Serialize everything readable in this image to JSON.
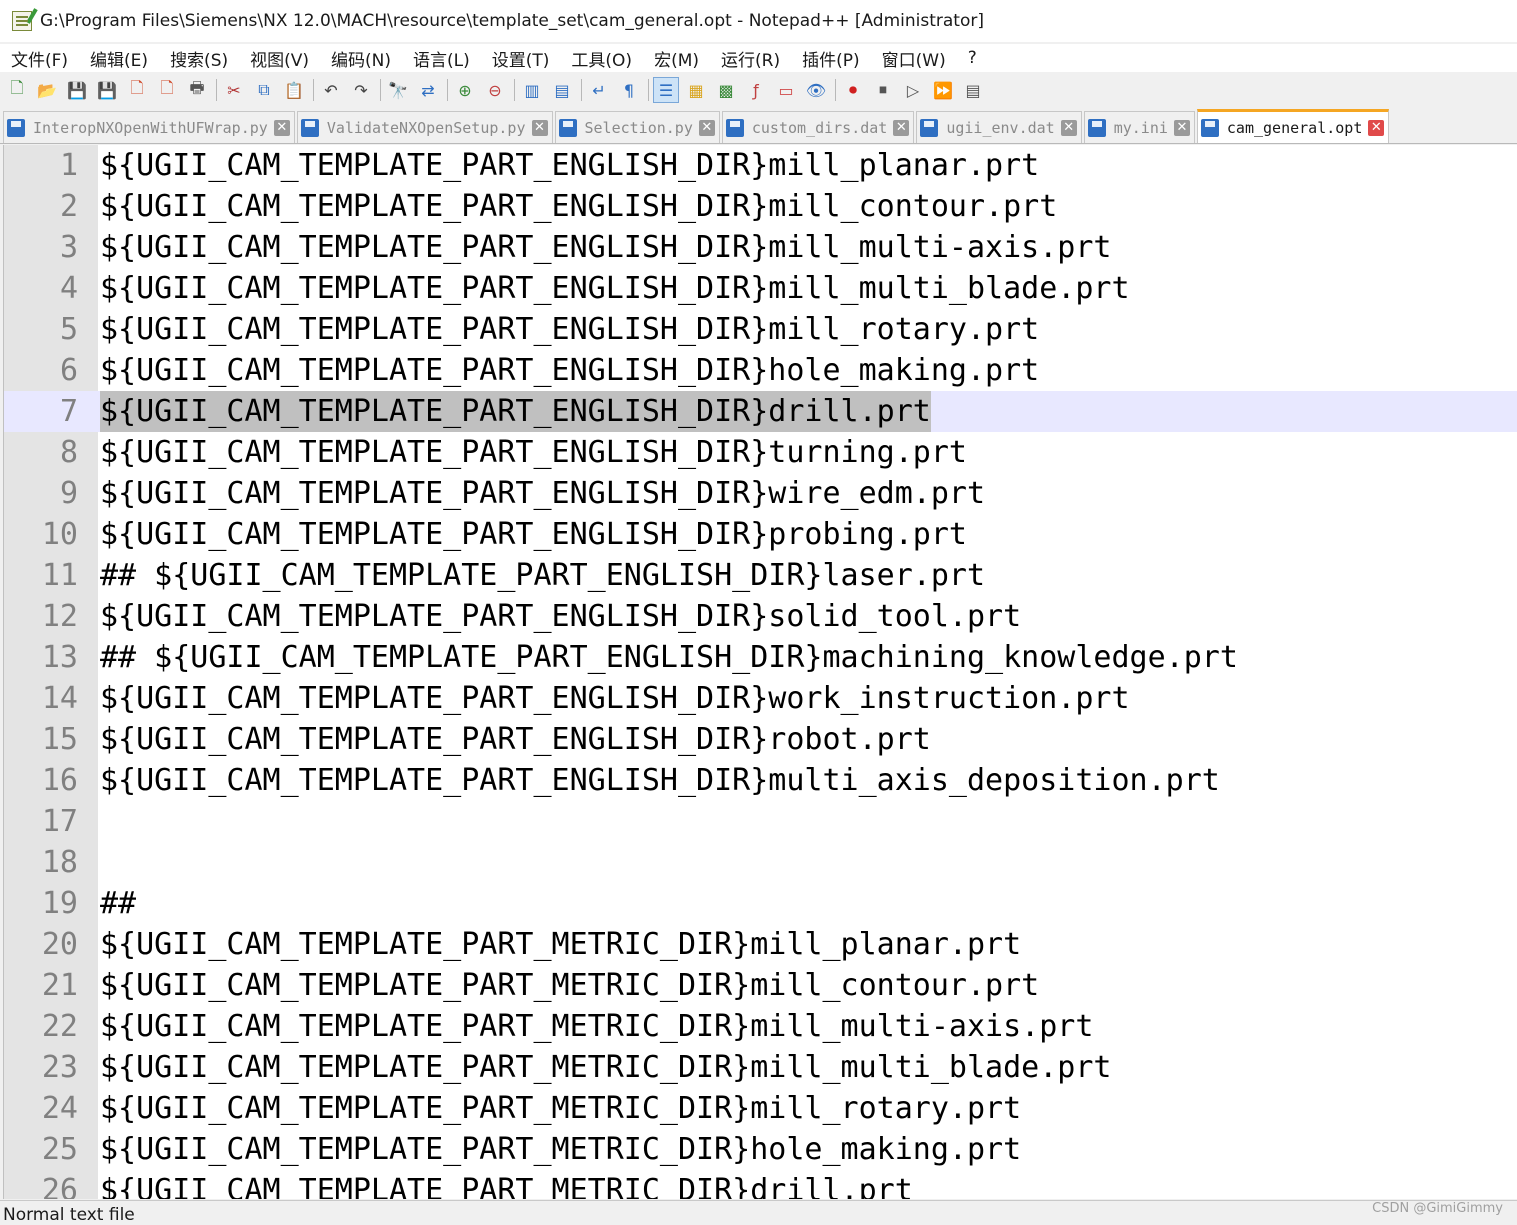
{
  "window": {
    "title": "G:\\Program Files\\Siemens\\NX 12.0\\MACH\\resource\\template_set\\cam_general.opt - Notepad++ [Administrator]"
  },
  "menu": [
    {
      "label": "文件(F)"
    },
    {
      "label": "编辑(E)"
    },
    {
      "label": "搜索(S)"
    },
    {
      "label": "视图(V)"
    },
    {
      "label": "编码(N)"
    },
    {
      "label": "语言(L)"
    },
    {
      "label": "设置(T)"
    },
    {
      "label": "工具(O)"
    },
    {
      "label": "宏(M)"
    },
    {
      "label": "运行(R)"
    },
    {
      "label": "插件(P)"
    },
    {
      "label": "窗口(W)"
    },
    {
      "label": "?"
    }
  ],
  "toolbar": [
    {
      "icon": "new-file-icon",
      "glyph": "🗋",
      "color": "#3a8a3a"
    },
    {
      "icon": "open-file-icon",
      "glyph": "📂",
      "color": "#d9a520"
    },
    {
      "icon": "save-icon",
      "glyph": "💾",
      "color": "#555555"
    },
    {
      "icon": "save-all-icon",
      "glyph": "💾",
      "color": "#2f6fc2"
    },
    {
      "icon": "close-file-icon",
      "glyph": "🗋",
      "color": "#d04a2a"
    },
    {
      "icon": "close-all-icon",
      "glyph": "🗋",
      "color": "#d04a2a"
    },
    {
      "icon": "print-icon",
      "glyph": "🖶",
      "color": "#555555"
    },
    {
      "sep": true
    },
    {
      "icon": "cut-icon",
      "glyph": "✂",
      "color": "#b03030"
    },
    {
      "icon": "copy-icon",
      "glyph": "⧉",
      "color": "#2f6fc2"
    },
    {
      "icon": "paste-icon",
      "glyph": "📋",
      "color": "#7a6a4a"
    },
    {
      "sep": true
    },
    {
      "icon": "undo-icon",
      "glyph": "↶",
      "color": "#444444"
    },
    {
      "icon": "redo-icon",
      "glyph": "↷",
      "color": "#444444"
    },
    {
      "sep": true
    },
    {
      "icon": "find-icon",
      "glyph": "🔭",
      "color": "#333333"
    },
    {
      "icon": "replace-icon",
      "glyph": "⇄",
      "color": "#2f6fc2"
    },
    {
      "sep": true
    },
    {
      "icon": "zoom-in-icon",
      "glyph": "⊕",
      "color": "#3a8a3a"
    },
    {
      "icon": "zoom-out-icon",
      "glyph": "⊖",
      "color": "#c04040"
    },
    {
      "sep": true
    },
    {
      "icon": "sync-vertical-icon",
      "glyph": "▥",
      "color": "#2f6fc2"
    },
    {
      "icon": "sync-horizontal-icon",
      "glyph": "▤",
      "color": "#2f6fc2"
    },
    {
      "sep": true
    },
    {
      "icon": "word-wrap-icon",
      "glyph": "↵",
      "color": "#2f6fc2"
    },
    {
      "icon": "show-all-chars-icon",
      "glyph": "¶",
      "color": "#2f6fc2"
    },
    {
      "sep": true
    },
    {
      "icon": "indent-guide-icon",
      "glyph": "☰",
      "color": "#2f6fc2",
      "active": true
    },
    {
      "icon": "user-defined-lang-icon",
      "glyph": "▦",
      "color": "#d9a520"
    },
    {
      "icon": "document-map-icon",
      "glyph": "▩",
      "color": "#3a8a3a"
    },
    {
      "icon": "function-list-icon",
      "glyph": "ƒ",
      "color": "#c04040"
    },
    {
      "icon": "folder-workspace-icon",
      "glyph": "▭",
      "color": "#d04a4a"
    },
    {
      "icon": "monitoring-icon",
      "glyph": "👁",
      "color": "#2f6fc2"
    },
    {
      "sep": true
    },
    {
      "icon": "record-macro-icon",
      "glyph": "⏺",
      "color": "#d02020"
    },
    {
      "icon": "stop-record-icon",
      "glyph": "⏹",
      "color": "#555555"
    },
    {
      "icon": "play-macro-icon",
      "glyph": "▷",
      "color": "#555555"
    },
    {
      "icon": "run-macro-multiple-icon",
      "glyph": "⏩",
      "color": "#2f6fc2"
    },
    {
      "icon": "save-macro-icon",
      "glyph": "▤",
      "color": "#555555"
    }
  ],
  "tabs": [
    {
      "label": "InteropNXOpenWithUFWrap.py",
      "active": false
    },
    {
      "label": "ValidateNXOpenSetup.py",
      "active": false
    },
    {
      "label": "Selection.py",
      "active": false
    },
    {
      "label": "custom_dirs.dat",
      "active": false
    },
    {
      "label": "ugii_env.dat",
      "active": false
    },
    {
      "label": "my.ini",
      "active": false
    },
    {
      "label": "cam_general.opt",
      "active": true
    }
  ],
  "editor": {
    "current_line": 7,
    "lines": [
      {
        "n": "1",
        "text": "${UGII_CAM_TEMPLATE_PART_ENGLISH_DIR}mill_planar.prt"
      },
      {
        "n": "2",
        "text": "${UGII_CAM_TEMPLATE_PART_ENGLISH_DIR}mill_contour.prt"
      },
      {
        "n": "3",
        "text": "${UGII_CAM_TEMPLATE_PART_ENGLISH_DIR}mill_multi-axis.prt"
      },
      {
        "n": "4",
        "text": "${UGII_CAM_TEMPLATE_PART_ENGLISH_DIR}mill_multi_blade.prt"
      },
      {
        "n": "5",
        "text": "${UGII_CAM_TEMPLATE_PART_ENGLISH_DIR}mill_rotary.prt"
      },
      {
        "n": "6",
        "text": "${UGII_CAM_TEMPLATE_PART_ENGLISH_DIR}hole_making.prt"
      },
      {
        "n": "7",
        "text": "${UGII_CAM_TEMPLATE_PART_ENGLISH_DIR}drill.prt"
      },
      {
        "n": "8",
        "text": "${UGII_CAM_TEMPLATE_PART_ENGLISH_DIR}turning.prt"
      },
      {
        "n": "9",
        "text": "${UGII_CAM_TEMPLATE_PART_ENGLISH_DIR}wire_edm.prt"
      },
      {
        "n": "10",
        "text": "${UGII_CAM_TEMPLATE_PART_ENGLISH_DIR}probing.prt"
      },
      {
        "n": "11",
        "text": "## ${UGII_CAM_TEMPLATE_PART_ENGLISH_DIR}laser.prt"
      },
      {
        "n": "12",
        "text": "${UGII_CAM_TEMPLATE_PART_ENGLISH_DIR}solid_tool.prt"
      },
      {
        "n": "13",
        "text": "## ${UGII_CAM_TEMPLATE_PART_ENGLISH_DIR}machining_knowledge.prt"
      },
      {
        "n": "14",
        "text": "${UGII_CAM_TEMPLATE_PART_ENGLISH_DIR}work_instruction.prt"
      },
      {
        "n": "15",
        "text": "${UGII_CAM_TEMPLATE_PART_ENGLISH_DIR}robot.prt"
      },
      {
        "n": "16",
        "text": "${UGII_CAM_TEMPLATE_PART_ENGLISH_DIR}multi_axis_deposition.prt"
      },
      {
        "n": "17",
        "text": ""
      },
      {
        "n": "18",
        "text": ""
      },
      {
        "n": "19",
        "text": "##"
      },
      {
        "n": "20",
        "text": "${UGII_CAM_TEMPLATE_PART_METRIC_DIR}mill_planar.prt"
      },
      {
        "n": "21",
        "text": "${UGII_CAM_TEMPLATE_PART_METRIC_DIR}mill_contour.prt"
      },
      {
        "n": "22",
        "text": "${UGII_CAM_TEMPLATE_PART_METRIC_DIR}mill_multi-axis.prt"
      },
      {
        "n": "23",
        "text": "${UGII_CAM_TEMPLATE_PART_METRIC_DIR}mill_multi_blade.prt"
      },
      {
        "n": "24",
        "text": "${UGII_CAM_TEMPLATE_PART_METRIC_DIR}mill_rotary.prt"
      },
      {
        "n": "25",
        "text": "${UGII_CAM_TEMPLATE_PART_METRIC_DIR}hole_making.prt"
      },
      {
        "n": "26",
        "text": "${UGII_CAM_TEMPLATE_PART_METRIC_DIR}drill.prt"
      }
    ]
  },
  "status": {
    "file_type": "Normal text file"
  },
  "watermark": "CSDN @GimiGimmy"
}
